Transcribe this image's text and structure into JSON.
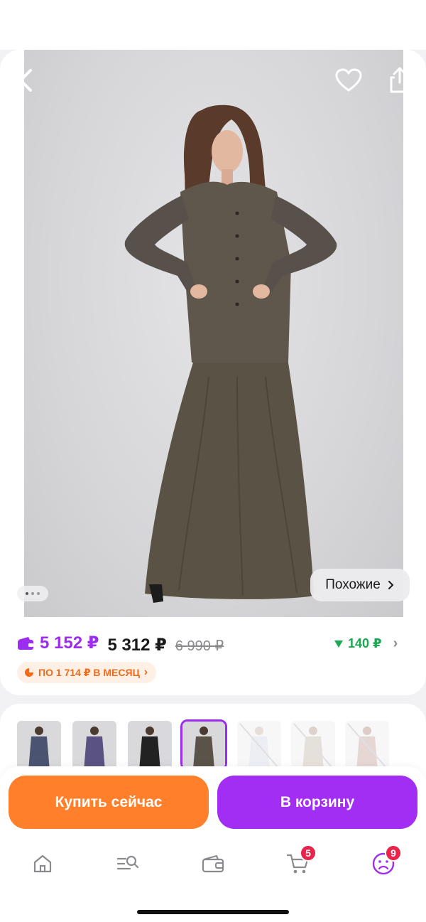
{
  "header": {
    "icons": [
      "chevron-left-icon",
      "heart-icon",
      "share-icon"
    ]
  },
  "gallery": {
    "similar_label": "Похожие",
    "page_dots": 3,
    "active_dot": 0
  },
  "prices": {
    "wallet_price": "5 152 ₽",
    "price": "5 312 ₽",
    "old_price": "6 990 ₽",
    "discount": "140 ₽",
    "installment": "ПО 1 714 ₽ В МЕСЯЦ"
  },
  "variants": {
    "count": 7,
    "selected_index": 3,
    "colors": [
      "#4a5370",
      "#5a5282",
      "#222222",
      "#5a5347",
      "#d8dbe6",
      "#c9bcb0",
      "#c9a8a4"
    ]
  },
  "actions": {
    "buy_now": "Купить сейчас",
    "add_to_cart": "В корзину"
  },
  "bottom_nav": {
    "items": [
      {
        "icon": "home-icon"
      },
      {
        "icon": "catalog-search-icon"
      },
      {
        "icon": "wallet-icon"
      },
      {
        "icon": "cart-icon",
        "badge": "5"
      },
      {
        "icon": "profile-icon",
        "badge": "9"
      }
    ]
  },
  "colors": {
    "accent_purple": "#a12ef2",
    "accent_orange": "#ff7f2a",
    "discount_green": "#1ca851",
    "badge_red": "#e8244a"
  }
}
